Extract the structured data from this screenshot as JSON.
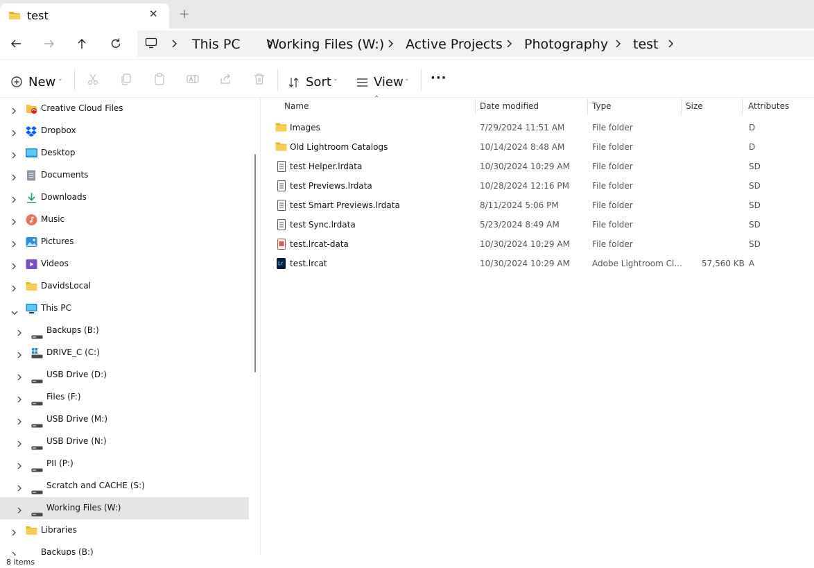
{
  "window": {
    "tab_title": "test",
    "new_tab_symbol": "+"
  },
  "nav": {
    "back_icon": "arrow-left-icon",
    "forward_icon": "arrow-right-icon",
    "up_icon": "arrow-up-icon",
    "refresh_icon": "refresh-icon"
  },
  "breadcrumb": [
    {
      "label": "This PC"
    },
    {
      "label": "Working Files (W:)"
    },
    {
      "label": "Active Projects"
    },
    {
      "label": "Photography"
    },
    {
      "label": "test"
    }
  ],
  "toolbar": {
    "new_label": "New",
    "sort_label": "Sort",
    "view_label": "View",
    "more_label": "···"
  },
  "sidebar": {
    "items": [
      {
        "label": "Creative Cloud Files",
        "icon": "creative-cloud-folder-icon"
      },
      {
        "label": "Dropbox",
        "icon": "dropbox-icon"
      },
      {
        "label": "Desktop",
        "icon": "desktop-icon"
      },
      {
        "label": "Documents",
        "icon": "documents-icon"
      },
      {
        "label": "Downloads",
        "icon": "downloads-icon"
      },
      {
        "label": "Music",
        "icon": "music-icon"
      },
      {
        "label": "Pictures",
        "icon": "pictures-icon"
      },
      {
        "label": "Videos",
        "icon": "videos-icon"
      },
      {
        "label": "DavidsLocal",
        "icon": "folder-icon"
      },
      {
        "label": "This PC",
        "icon": "this-pc-icon"
      },
      {
        "label": "Backups (B:)",
        "icon": "drive-icon"
      },
      {
        "label": "DRIVE_C (C:)",
        "icon": "windows-drive-icon"
      },
      {
        "label": "USB Drive (D:)",
        "icon": "drive-icon"
      },
      {
        "label": "Files (F:)",
        "icon": "drive-icon"
      },
      {
        "label": "USB Drive (M:)",
        "icon": "drive-icon"
      },
      {
        "label": "USB Drive (N:)",
        "icon": "drive-icon"
      },
      {
        "label": "PII (P:)",
        "icon": "drive-icon"
      },
      {
        "label": "Scratch and CACHE (S:)",
        "icon": "drive-icon"
      },
      {
        "label": "Working Files (W:)",
        "icon": "drive-icon"
      },
      {
        "label": "Libraries",
        "icon": "libraries-icon"
      },
      {
        "label": "Backups (B:)",
        "icon": "drive-icon"
      }
    ]
  },
  "columns": {
    "name": "Name",
    "date": "Date modified",
    "type": "Type",
    "size": "Size",
    "attributes": "Attributes"
  },
  "files": [
    {
      "name": "Images",
      "date": "7/29/2024 11:51 AM",
      "type": "File folder",
      "size": "",
      "attributes": "D",
      "icon": "folder-icon"
    },
    {
      "name": "Old Lightroom Catalogs",
      "date": "10/14/2024 8:48 AM",
      "type": "File folder",
      "size": "",
      "attributes": "D",
      "icon": "folder-icon"
    },
    {
      "name": "test Helper.lrdata",
      "date": "10/30/2024 10:29 AM",
      "type": "File folder",
      "size": "",
      "attributes": "SD",
      "icon": "document-icon"
    },
    {
      "name": "test Previews.lrdata",
      "date": "10/28/2024 12:16 PM",
      "type": "File folder",
      "size": "",
      "attributes": "SD",
      "icon": "document-icon"
    },
    {
      "name": "test Smart Previews.lrdata",
      "date": "8/11/2024 5:06 PM",
      "type": "File folder",
      "size": "",
      "attributes": "SD",
      "icon": "document-icon"
    },
    {
      "name": "test Sync.lrdata",
      "date": "5/23/2024 8:49 AM",
      "type": "File folder",
      "size": "",
      "attributes": "SD",
      "icon": "document-icon"
    },
    {
      "name": "test.lrcat-data",
      "date": "10/30/2024 10:29 AM",
      "type": "File folder",
      "size": "",
      "attributes": "SD",
      "icon": "lrcat-data-icon"
    },
    {
      "name": "test.lrcat",
      "date": "10/30/2024 10:29 AM",
      "type": "Adobe Lightroom Cl...",
      "size": "57,560 KB",
      "attributes": "A",
      "icon": "lightroom-catalog-icon"
    }
  ],
  "status": {
    "item_count": "8 items"
  },
  "colors": {
    "tabstrip_bg": "#e9e9e9",
    "breadcrumb_bg": "#f3f3f3",
    "selected_item_bg": "#e5e5e5",
    "folder_yellow": "#f4c443",
    "accent_blue": "#0067c0"
  }
}
